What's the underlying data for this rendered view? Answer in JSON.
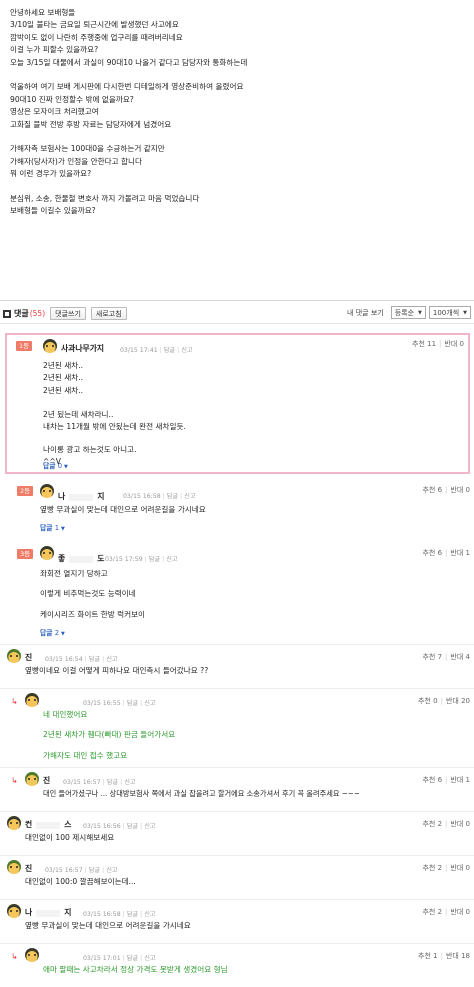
{
  "post": {
    "lines": [
      "안녕하세요 보배형들",
      "3/10일 불타는 금요일 퇴근시간에 발생했던 사고에요",
      "깜박이도 없이 나란히 주행중에 업구리를 때려버리네요",
      "이걸 누가 피할수 있을까요?",
      "오늘 3/15일 대물에서 과실이 90대10 나올거 같다고 담당자와 통화하는데",
      "",
      "억울하여 여기 보배 게시판에 다시한번 디테일하게 영상준비하여 올렸어요",
      "90대10 진짜 인정할수 밖에 없을까요?",
      "영상은 모자이크 처리했고여",
      "고화질 블박 전방 후방 자료는 담당자에게 넘겼어요",
      "",
      "가해자측 보험사는 100대0을 수긍하는거 같지만",
      "가해자(당사자)가 인정을 안한다고 합니다",
      "뭐 이런 경우가 있을까요?",
      "",
      "분심위, 소송, 한물철 변호사 까지 가볼려고 마음 먹었습니다",
      "보배형들 이길수 있을까요?"
    ]
  },
  "toolbar": {
    "title": "댓글",
    "count": "(55)",
    "write_label": "댓글쓰기",
    "refresh_label": "새로고침",
    "my_comments_label": "내 댓글 보기",
    "sort_value": "등록순",
    "per_page_value": "100개씩"
  },
  "common": {
    "reply_label": "답글",
    "report_label": "신고",
    "recommend_label": "추천",
    "oppose_label": "반대"
  },
  "comments": [
    {
      "rank": "1등",
      "name": "사과나무가지",
      "time": "03/15 17:41",
      "recommend": "11",
      "oppose": "0",
      "lines": [
        "2년된 새차..",
        "2년된 새차..",
        "2년된 새차..",
        "",
        "2년 됬는데 새차라니..",
        "내차는 11개월 밖에 안됬는데 완전 새차일듯.",
        "",
        "나이롱 광고 하는것도 아니고.",
        "^^V"
      ],
      "reply_count": "0"
    },
    {
      "rank": "2등",
      "name_a": "나",
      "name_b": "지",
      "time": "03/15 16:58",
      "recommend": "6",
      "oppose": "0",
      "lines": [
        "옆빵 무과실이 맞는데 대인으로 어려운길을 가시네요"
      ],
      "reply_count": "1"
    },
    {
      "rank": "3등",
      "name_a": "좋",
      "name_b": "도",
      "time": "03/15 17:59",
      "recommend": "6",
      "oppose": "1",
      "lines": [
        "좌회전 열지기 당하고",
        "",
        "이렇게 비추먹는것도 능력이네",
        "",
        "케이시리즈 화이트 한방 럭커보이"
      ],
      "reply_count": "2"
    },
    {
      "name": "진",
      "time": "03/15 16:54",
      "recommend": "7",
      "oppose": "4",
      "lines": [
        "옆빵이네요 이걸 어떻게 피하나요 대인측시 들어갔나요 ??"
      ]
    },
    {
      "time": "03/15 16:55",
      "recommend": "0",
      "oppose": "20",
      "lines": [
        "네 대인했어요",
        "",
        "2년된 새차가 휀다(빠대) 판금 들어가서요",
        "",
        "가해자도 대인 접수 했고요"
      ]
    },
    {
      "name": "진",
      "time": "03/15 16:57",
      "recommend": "6",
      "oppose": "1",
      "lines": [
        "대인 들어가셨구나 ... 상대방보험사 쪽에서 과실 잡을려고 할거에요 소송가셔서 후기 꼭 올려주세요 ~~~"
      ]
    },
    {
      "name": "컨",
      "name_b": "스",
      "time": "03/15 16:56",
      "recommend": "2",
      "oppose": "0",
      "lines": [
        "대인없이 100 제시해보세요"
      ]
    },
    {
      "name": "진",
      "time": "03/15 16:57",
      "recommend": "2",
      "oppose": "0",
      "lines": [
        "대인없이 100:0 깔끔해보이는데..."
      ]
    },
    {
      "name": "나",
      "name_b": "지",
      "time": "03/15 16:58",
      "recommend": "2",
      "oppose": "0",
      "lines": [
        "옆빵 무과실이 맞는데 대인으로 어려운길을 가시네요"
      ]
    },
    {
      "time": "03/15 17:01",
      "recommend": "1",
      "oppose": "18",
      "lines": [
        "애마 팔때는 사고차라서 정상 가격도 못받게 생겼어요 형님"
      ]
    }
  ],
  "colors": {
    "accent_red": "#e53b3b",
    "best_border": "#f2b5c8",
    "reply_green": "#2b9a2b",
    "link_blue": "#2b5fbf"
  }
}
